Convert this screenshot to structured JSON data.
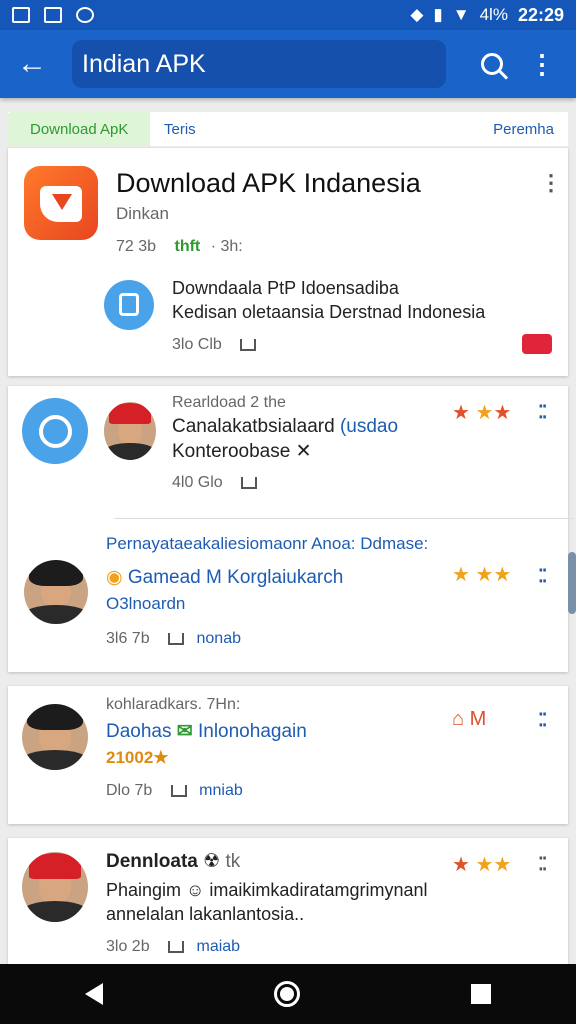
{
  "status_bar": {
    "signal_text": "4l%",
    "time": "22:29"
  },
  "app_bar": {
    "search_value": "Indian APK",
    "back_icon": "back-arrow-icon",
    "search_icon": "search-icon",
    "more_icon": "more-vert-icon"
  },
  "tabs": {
    "active": "Download ApK",
    "second": "Teris",
    "right": "Peremha"
  },
  "featured": {
    "title": "Download APK Indanesia",
    "subtitle": "Dinkan",
    "size": "72 3b",
    "tag": "thft",
    "extra": "· 3h:",
    "line1": "Downdaala PtP Idoensadiba",
    "line2": "Kedisan oletaansia Derstnad Indonesia",
    "meta": "3lo Clb"
  },
  "post1": {
    "head": "Rearldoad 2 the",
    "line1a": "Canalakatbsialaard",
    "line1b": "(usdao",
    "line2": "Konteroobase ✕",
    "meta": "4l0 Glo"
  },
  "post2": {
    "head": "Pernayataeakaliesiomaonr Anoa: Ddmase:",
    "name": "Gamead M",
    "name2": "Korglaiukarch",
    "sub": "O3lnoardn",
    "meta": "3l6 7b",
    "action": "nonab"
  },
  "post3": {
    "head": "kohlaradkars. 7Hn:",
    "name": "Daohas",
    "name2": "Inlonohagain",
    "score": "21002★",
    "meta": "Dlo 7b",
    "action": "mniab"
  },
  "post4": {
    "name": "Dennloata",
    "name_tail": "tk",
    "line1": "Phaingim ☺ imaikimkadiratamgrimynanl",
    "line2": "annelalan lakanlantosia..",
    "meta": "3lo 2b",
    "action": "maiab"
  },
  "colors": {
    "appbar": "#1a63c9",
    "accent": "#1e5cb3",
    "green": "#2f9a2f",
    "badge": "#e0253b"
  }
}
